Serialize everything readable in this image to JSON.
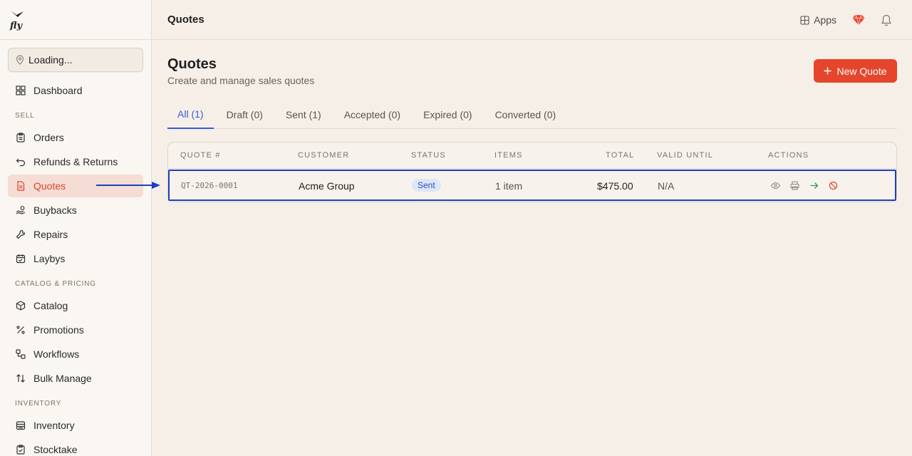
{
  "app": {
    "logo_text": "fly"
  },
  "sidebar": {
    "location": "Loading...",
    "dashboard": "Dashboard",
    "sections": {
      "sell": "SELL",
      "catalog": "CATALOG & PRICING",
      "inventory": "INVENTORY"
    },
    "sell_items": [
      {
        "label": "Orders",
        "icon": "clipboard-icon"
      },
      {
        "label": "Refunds & Returns",
        "icon": "undo-icon"
      },
      {
        "label": "Quotes",
        "icon": "document-icon"
      },
      {
        "label": "Buybacks",
        "icon": "hand-coins-icon"
      },
      {
        "label": "Repairs",
        "icon": "wrench-icon"
      },
      {
        "label": "Laybys",
        "icon": "calendar-icon"
      }
    ],
    "catalog_items": [
      {
        "label": "Catalog",
        "icon": "box-icon"
      },
      {
        "label": "Promotions",
        "icon": "percent-icon"
      },
      {
        "label": "Workflows",
        "icon": "workflow-icon"
      },
      {
        "label": "Bulk Manage",
        "icon": "sort-arrows-icon"
      }
    ],
    "inventory_items": [
      {
        "label": "Inventory",
        "icon": "stack-icon"
      },
      {
        "label": "Stocktake",
        "icon": "clipboard-check-icon"
      }
    ]
  },
  "header": {
    "title": "Quotes",
    "apps_label": "Apps"
  },
  "page": {
    "title": "Quotes",
    "subtitle": "Create and manage sales quotes",
    "new_button": "New Quote"
  },
  "tabs": [
    "All (1)",
    "Draft (0)",
    "Sent (1)",
    "Accepted (0)",
    "Expired (0)",
    "Converted (0)"
  ],
  "table": {
    "columns": [
      "QUOTE #",
      "CUSTOMER",
      "STATUS",
      "ITEMS",
      "TOTAL",
      "VALID UNTIL",
      "ACTIONS"
    ],
    "rows": [
      {
        "quote": "QT-2026-0001",
        "customer": "Acme Group",
        "status": "Sent",
        "items": "1 item",
        "total": "$475.00",
        "valid_until": "N/A"
      }
    ]
  },
  "colors": {
    "accent": "#e5452b",
    "tab_active": "#3a5bd9",
    "highlight": "#1d3fc4"
  }
}
